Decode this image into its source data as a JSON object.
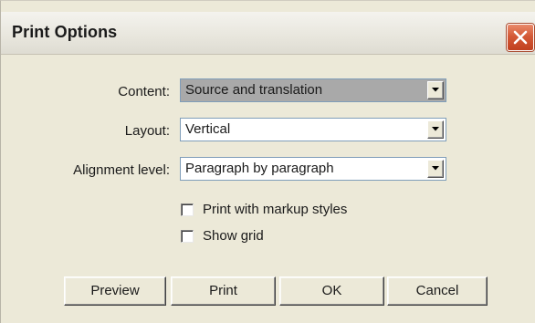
{
  "window": {
    "title": "Print Options",
    "close_icon": "close-x-icon"
  },
  "fields": {
    "content": {
      "label": "Content:",
      "value": "Source and translation"
    },
    "layout": {
      "label": "Layout:",
      "value": "Vertical"
    },
    "alignment": {
      "label": "Alignment level:",
      "value": "Paragraph by paragraph"
    }
  },
  "options": {
    "markup_styles": {
      "label": "Print with markup styles",
      "checked": false
    },
    "show_grid": {
      "label": "Show grid",
      "checked": false
    }
  },
  "buttons": {
    "preview": "Preview",
    "print": "Print",
    "ok": "OK",
    "cancel": "Cancel"
  },
  "colors": {
    "dialog_bg": "#ece9d8",
    "close_red": "#d45a37",
    "readonly_combo": "#a9a9a9"
  }
}
